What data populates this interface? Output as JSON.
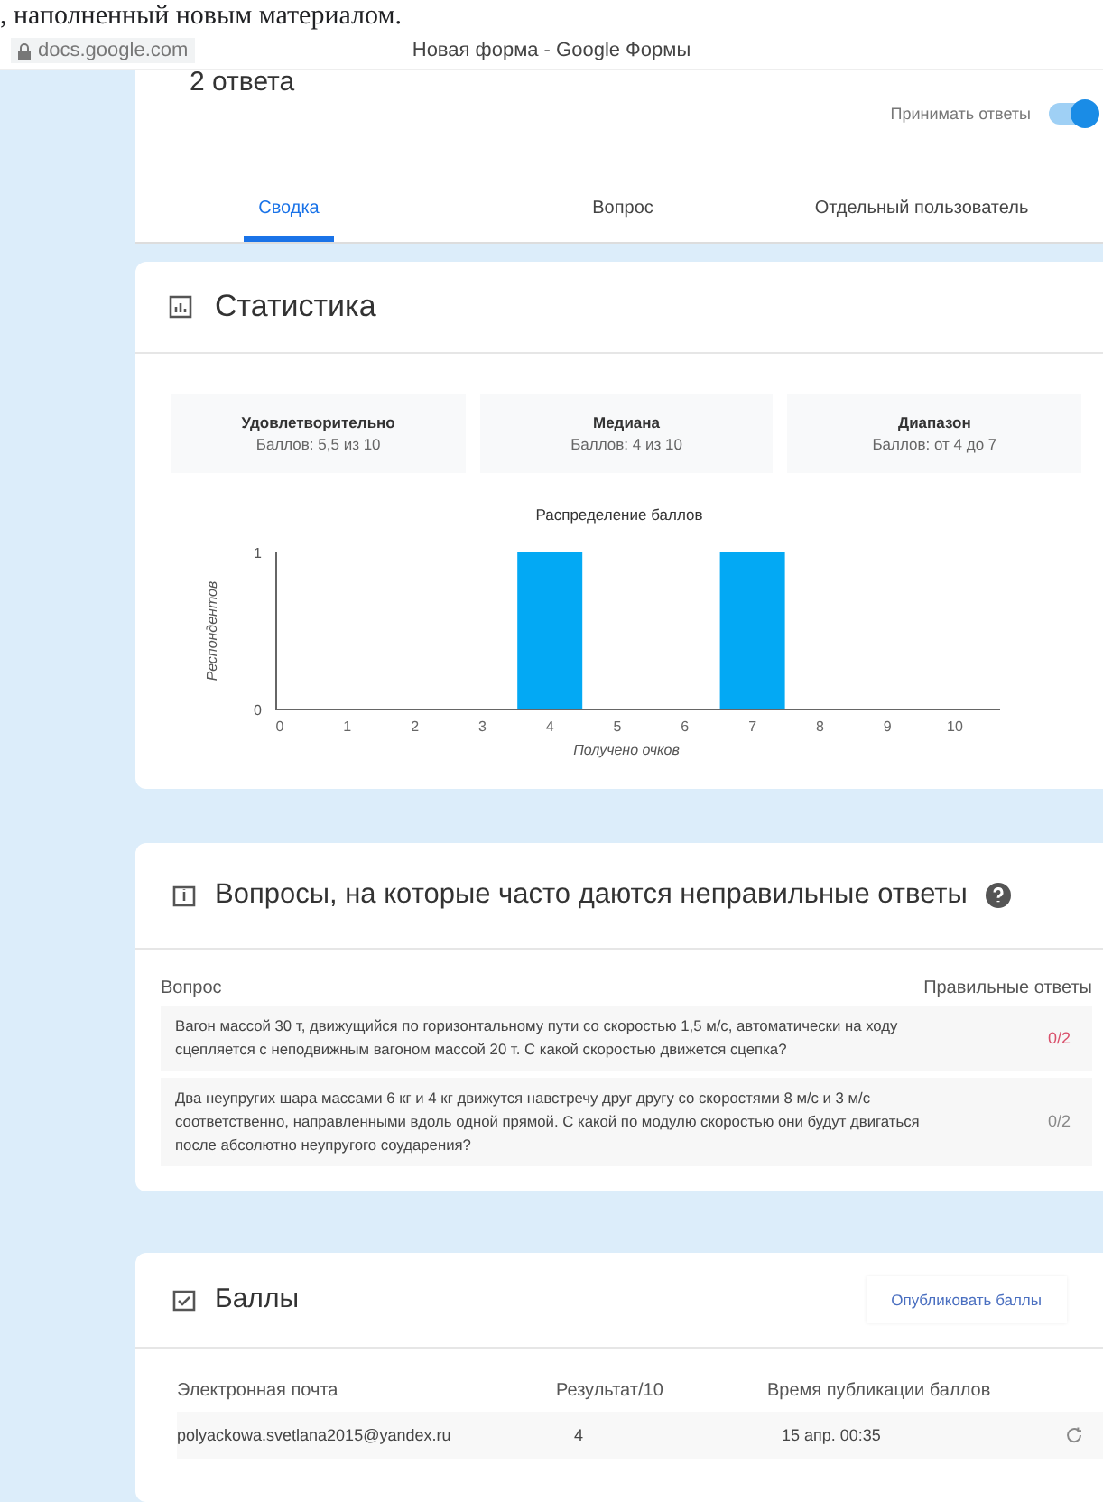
{
  "page_text": ", наполненный новым материалом.",
  "browser": {
    "address": "docs.google.com",
    "title": "Новая форма - Google Формы"
  },
  "header": {
    "responses": "2 ответа",
    "accepting": {
      "label": "Принимать ответы",
      "on": true
    }
  },
  "tabs": [
    {
      "label": "Сводка",
      "selected": true
    },
    {
      "label": "Вопрос",
      "selected": false
    },
    {
      "label": "Отдельный пользователь",
      "selected": false
    }
  ],
  "statistics": {
    "title": "Статистика",
    "cards": [
      {
        "label": "Удовлетворительно",
        "value": "Баллов: 5,5 из 10"
      },
      {
        "label": "Медиана",
        "value": "Баллов: 4 из 10"
      },
      {
        "label": "Диапазон",
        "value": "Баллов: от 4 до 7"
      }
    ],
    "chart_data": {
      "type": "bar",
      "title": "Распределение баллов",
      "xlabel": "Получено очков",
      "ylabel": "Респондентов",
      "categories": [
        "0",
        "1",
        "2",
        "3",
        "4",
        "5",
        "6",
        "7",
        "8",
        "9",
        "10"
      ],
      "series": [
        {
          "color": "#03a9f4",
          "values": [
            0,
            0,
            0,
            0,
            1,
            0,
            0,
            1,
            0,
            0,
            0
          ]
        }
      ],
      "ylim": [
        0,
        1
      ],
      "yticks": [
        0,
        1
      ]
    }
  },
  "frequent_wrong": {
    "title": "Вопросы, на которые часто даются неправильные ответы",
    "columns": [
      "Вопрос",
      "Правильные ответы"
    ],
    "rows": [
      {
        "question": "Вагон массой 30 т, движущийся по горизонтальному пути со скоростью 1,5 м/с, автоматически на ходу сцепляется с неподвижным вагоном массой 20 т. С какой скоростью движется сцепка?",
        "correct": "0/2",
        "flagged": true
      },
      {
        "question": "Два неупругих шара массами 6 кг и 4 кг движутся навстречу друг другу со скоростями 8 м/с и 3 м/с соответственно, направленными вдоль одной прямой. С какой по модулю скоростью они будут двигаться после абсолютно неупругого соударения?",
        "correct": "0/2",
        "flagged": false
      }
    ]
  },
  "scores": {
    "title": "Баллы",
    "publish_button": "Опубликовать баллы",
    "columns": [
      "Электронная почта",
      "Результат/10",
      "Время публикации баллов"
    ],
    "rows": [
      {
        "email": "polyackowa.svetlana2015@yandex.ru",
        "result": "4",
        "published": "15 апр. 00:35"
      }
    ]
  }
}
